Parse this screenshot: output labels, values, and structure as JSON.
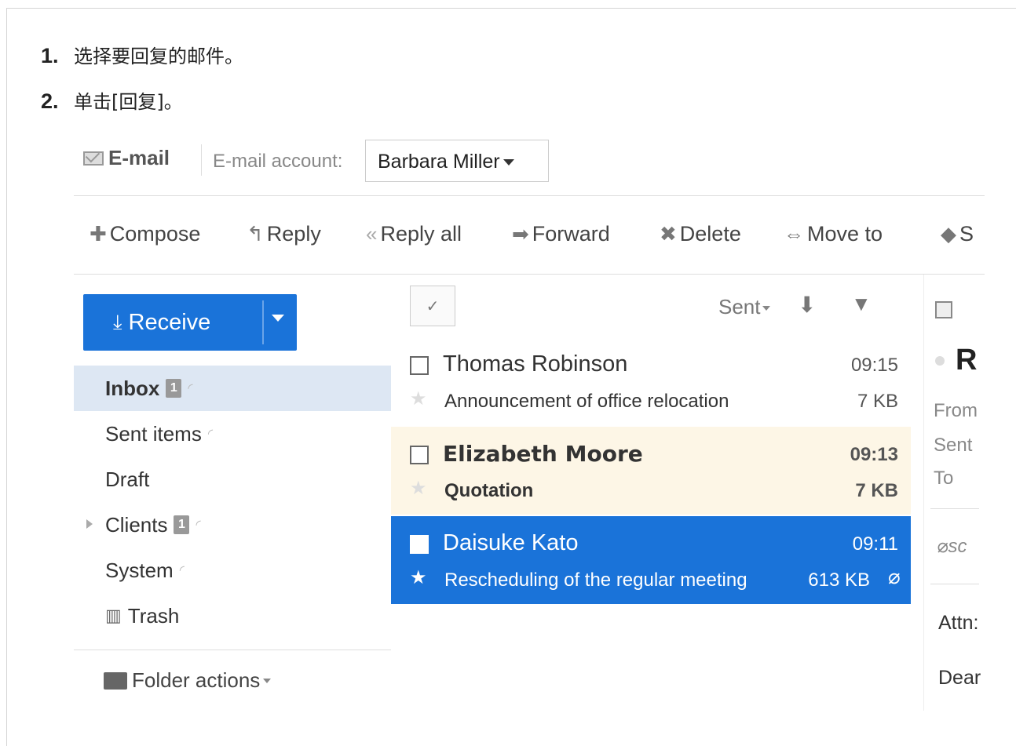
{
  "steps": [
    {
      "num": "1.",
      "text": "选择要回复的邮件。"
    },
    {
      "num": "2.",
      "text": "单击[回复]。"
    }
  ],
  "header": {
    "app_title": "E-mail",
    "account_label": "E-mail account:",
    "account_value": "Barbara Miller"
  },
  "toolbar": {
    "compose": "Compose",
    "reply": "Reply",
    "reply_all": "Reply all",
    "forward": "Forward",
    "delete": "Delete",
    "move_to": "Move to",
    "more": "S"
  },
  "sidebar": {
    "receive_label": "Receive",
    "folders": [
      {
        "label": "Inbox",
        "badge": "1"
      },
      {
        "label": "Sent items"
      },
      {
        "label": "Draft"
      },
      {
        "label": "Clients",
        "badge": "1"
      },
      {
        "label": "System"
      },
      {
        "label": "Trash"
      }
    ],
    "folder_actions": "Folder actions"
  },
  "list": {
    "sort_label": "Sent",
    "messages": [
      {
        "from": "Thomas Robinson",
        "time": "09:15",
        "subject": "Announcement of office relocation",
        "size": "7 KB"
      },
      {
        "from": "Elizabeth Moore",
        "time": "09:13",
        "subject": "Quotation",
        "size": "7 KB"
      },
      {
        "from": "Daisuke Kato",
        "time": "09:11",
        "subject": "Rescheduling of the regular meeting",
        "size": "613 KB"
      }
    ]
  },
  "preview": {
    "title_initial": "R",
    "from_label": "From",
    "sent_label": "Sent",
    "to_label": "To",
    "attachment": "sc",
    "attn": "Attn:",
    "dear": "Dear"
  },
  "colors": {
    "accent": "#1a73d9",
    "unread_bg": "#fdf6e6",
    "active_folder_bg": "#dde7f3"
  }
}
